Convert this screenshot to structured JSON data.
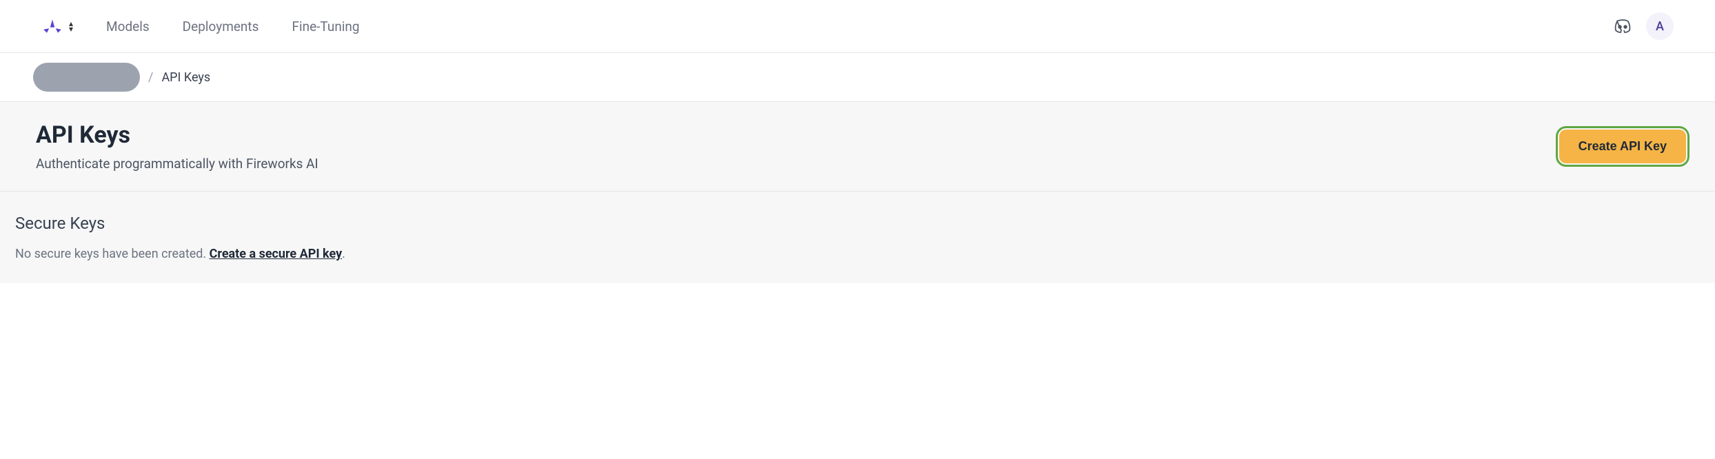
{
  "nav": {
    "links": [
      {
        "label": "Models"
      },
      {
        "label": "Deployments"
      },
      {
        "label": "Fine-Tuning"
      }
    ],
    "avatar_initial": "A"
  },
  "breadcrumb": {
    "separator": "/",
    "current": "API Keys"
  },
  "header": {
    "title": "API Keys",
    "subtitle": "Authenticate programmatically with Fireworks AI",
    "create_button": "Create API Key"
  },
  "secure": {
    "heading": "Secure Keys",
    "empty_prefix": "No secure keys have been created. ",
    "create_link": "Create a secure API key",
    "period": "."
  }
}
